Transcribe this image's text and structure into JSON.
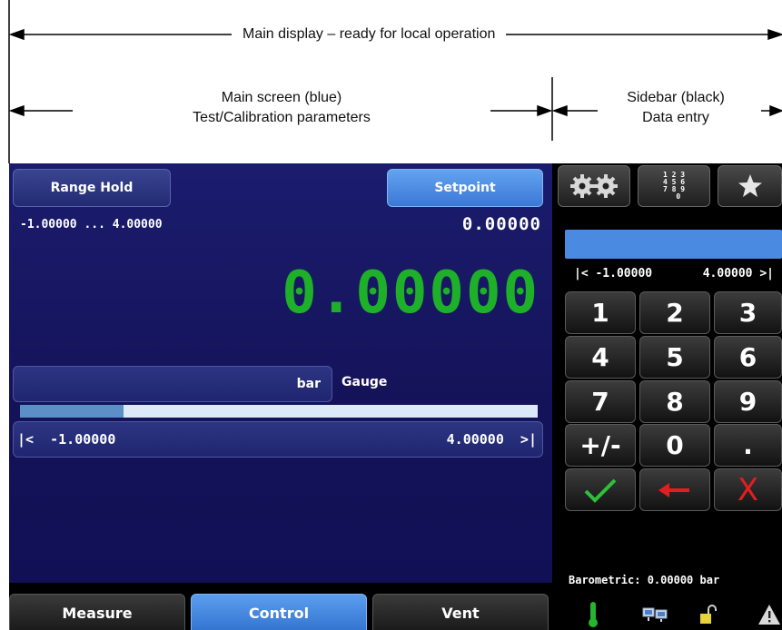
{
  "annotations": {
    "main_display": "Main display – ready for local operation",
    "main_screen_line1": "Main screen (blue)",
    "main_screen_line2": "Test/Calibration parameters",
    "sidebar_line1": "Sidebar (black)",
    "sidebar_line2": "Data entry"
  },
  "main": {
    "range_hold_button": "Range Hold",
    "setpoint_button": "Setpoint",
    "range_text": "-1.00000 ... 4.00000",
    "setpoint_value": "0.00000",
    "reading": "0.00000",
    "reading_color": "#1db028",
    "unit": "bar",
    "mode": "Gauge",
    "progress_fraction": 0.2,
    "range_min_label": "|<  -1.00000",
    "range_max_label": "4.00000  >|"
  },
  "tabs": [
    {
      "label": "Measure",
      "active": false
    },
    {
      "label": "Control",
      "active": true
    },
    {
      "label": "Vent",
      "active": false
    }
  ],
  "sidebar": {
    "top_buttons": [
      "gear-icon",
      "keypad-icon",
      "star-icon"
    ],
    "keypad_glyph": "1 2 3\n4 5 6\n7 8 9\n  0",
    "entry_min": "|< -1.00000",
    "entry_max": "4.00000 >|",
    "keys": [
      "1",
      "2",
      "3",
      "4",
      "5",
      "6",
      "7",
      "8",
      "9",
      "+/-",
      "0",
      "."
    ],
    "action_keys": {
      "enter": "✓",
      "backspace": "←",
      "cancel": "X"
    },
    "barometric": "Barometric: 0.00000 bar",
    "status_icons": [
      "thermometer-icon",
      "network-icon",
      "lock-icon",
      "warning-icon"
    ]
  }
}
